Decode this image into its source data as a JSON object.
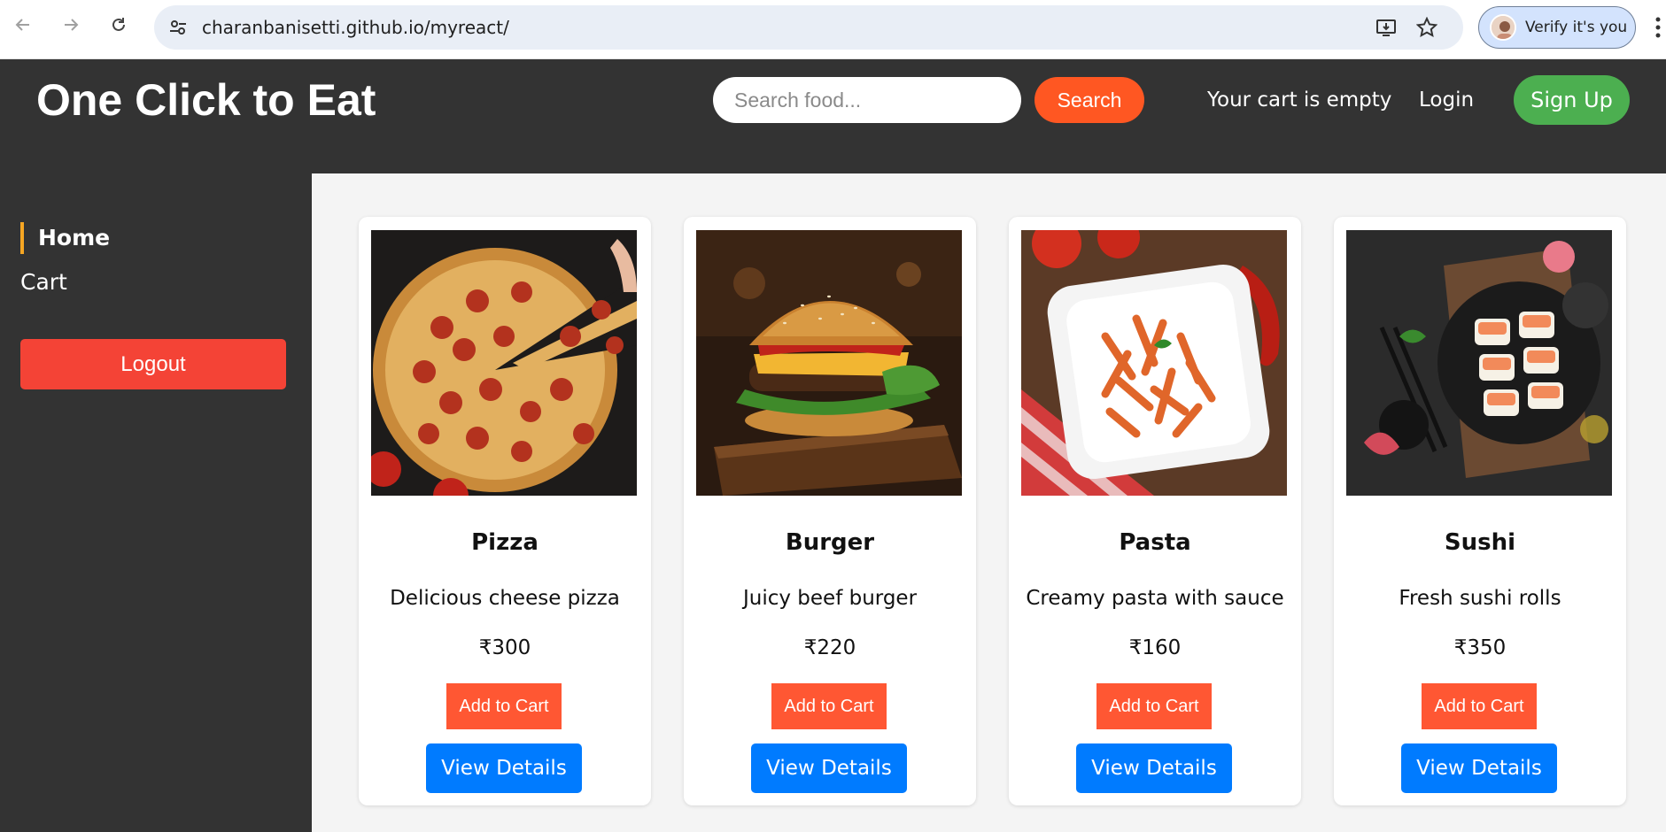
{
  "browser": {
    "url": "charanbanisetti.github.io/myreact/",
    "profile_label": "Verify it's you"
  },
  "header": {
    "brand": "One Click to Eat",
    "search_placeholder": "Search food...",
    "search_label": "Search",
    "cart_status": "Your cart is empty",
    "login_label": "Login",
    "signup_label": "Sign Up"
  },
  "sidebar": {
    "items": [
      {
        "label": "Home",
        "active": true
      },
      {
        "label": "Cart",
        "active": false
      }
    ],
    "logout_label": "Logout"
  },
  "products": [
    {
      "name": "Pizza",
      "description": "Delicious cheese pizza",
      "price": "₹300",
      "add_label": "Add to Cart",
      "details_label": "View Details",
      "image": "pizza-photo"
    },
    {
      "name": "Burger",
      "description": "Juicy beef burger",
      "price": "₹220",
      "add_label": "Add to Cart",
      "details_label": "View Details",
      "image": "burger-photo"
    },
    {
      "name": "Pasta",
      "description": "Creamy pasta with sauce",
      "price": "₹160",
      "add_label": "Add to Cart",
      "details_label": "View Details",
      "image": "pasta-photo"
    },
    {
      "name": "Sushi",
      "description": "Fresh sushi rolls",
      "price": "₹350",
      "add_label": "Add to Cart",
      "details_label": "View Details",
      "image": "sushi-photo"
    }
  ],
  "colors": {
    "header_bg": "#333333",
    "search_button": "#ff5722",
    "signup_button": "#4caf50",
    "logout_button": "#f44336",
    "add_to_cart": "#ff5733",
    "view_details": "#007bff",
    "active_indicator": "#f5a623"
  }
}
